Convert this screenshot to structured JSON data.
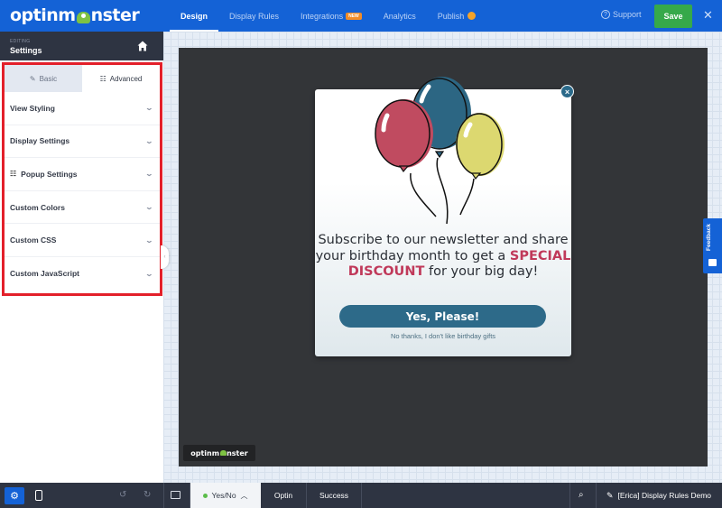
{
  "header": {
    "logo": {
      "left": "optinm",
      "right": "nster"
    },
    "nav": [
      {
        "label": "Design",
        "active": true
      },
      {
        "label": "Display Rules",
        "active": false
      },
      {
        "label": "Integrations",
        "badge": "NEW",
        "active": false
      },
      {
        "label": "Analytics",
        "active": false
      },
      {
        "label": "Publish",
        "active": false
      }
    ],
    "support_label": "Support",
    "save_label": "Save",
    "close_icon": "close-icon"
  },
  "sidebar": {
    "editing_label": "EDITING",
    "title": "Settings",
    "tabs": [
      {
        "label": "Basic",
        "icon": "pencil-icon",
        "active": true
      },
      {
        "label": "Advanced",
        "icon": "sliders-icon",
        "active": false
      }
    ],
    "sections": [
      {
        "label": "View Styling"
      },
      {
        "label": "Display Settings"
      },
      {
        "label": "Popup Settings",
        "icon": "sliders-icon"
      },
      {
        "label": "Custom Colors"
      },
      {
        "label": "Custom CSS"
      },
      {
        "label": "Custom JavaScript"
      }
    ]
  },
  "popup": {
    "headline_before": "Subscribe to our newsletter and share your birthday month to get a ",
    "headline_highlight": "SPECIAL DISCOUNT",
    "headline_after": " for your big day!",
    "cta_label": "Yes, Please!",
    "decline_label": "No thanks, I don't like birthday gifts",
    "colors": {
      "accent": "#2d6a89",
      "highlight": "#c0395a"
    },
    "balloon_colors": [
      "#c04b60",
      "#2c6683",
      "#dcd870"
    ]
  },
  "canvas": {
    "brand_badge": {
      "left": "optinm",
      "right": "nster"
    },
    "feedback_label": "Feedback"
  },
  "bottombar": {
    "views": [
      {
        "label": "Yes/No",
        "active": true,
        "status": "green"
      },
      {
        "label": "Optin",
        "active": false
      },
      {
        "label": "Success",
        "active": false
      }
    ],
    "campaign_name": "[Erica] Display Rules Demo"
  },
  "colors": {
    "brand_blue": "#1462d6",
    "save_green": "#36a94a",
    "sidebar_dark": "#2e3442",
    "highlight_red": "#e3202a"
  }
}
